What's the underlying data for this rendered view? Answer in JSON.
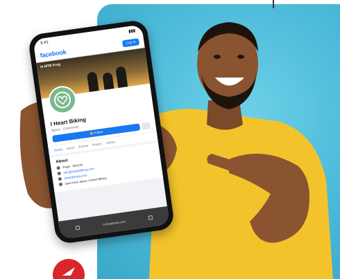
{
  "phone": {
    "status_time": "9:41",
    "status_icons": "▮▮▮",
    "brand": "facebook",
    "header_button": "Log In",
    "cover_tag": "I♥ MTB Frog",
    "page_name": "I Heart Biking",
    "page_meta": "Sports · Community",
    "like_button": "👍 Follow",
    "tabs": [
      "Home",
      "About",
      "Events",
      "Photos",
      "Videos"
    ],
    "about_title": "About",
    "about_items": [
      {
        "icon": "flag-icon",
        "text": "Page · Bicycle",
        "link": false
      },
      {
        "icon": "mail-icon",
        "text": "info@iheartbiking.com",
        "link": true
      },
      {
        "icon": "globe-icon",
        "text": "iheartbiking.com",
        "link": true
      },
      {
        "icon": "pin-icon",
        "text": "See more about I Heart Biking",
        "link": false
      }
    ],
    "bottom_url": "m.facebook.com"
  },
  "colors": {
    "background": "#4bbad8",
    "shirt": "#f3c32c",
    "facebook_blue": "#1877f2",
    "badge_red": "#d9262b"
  }
}
